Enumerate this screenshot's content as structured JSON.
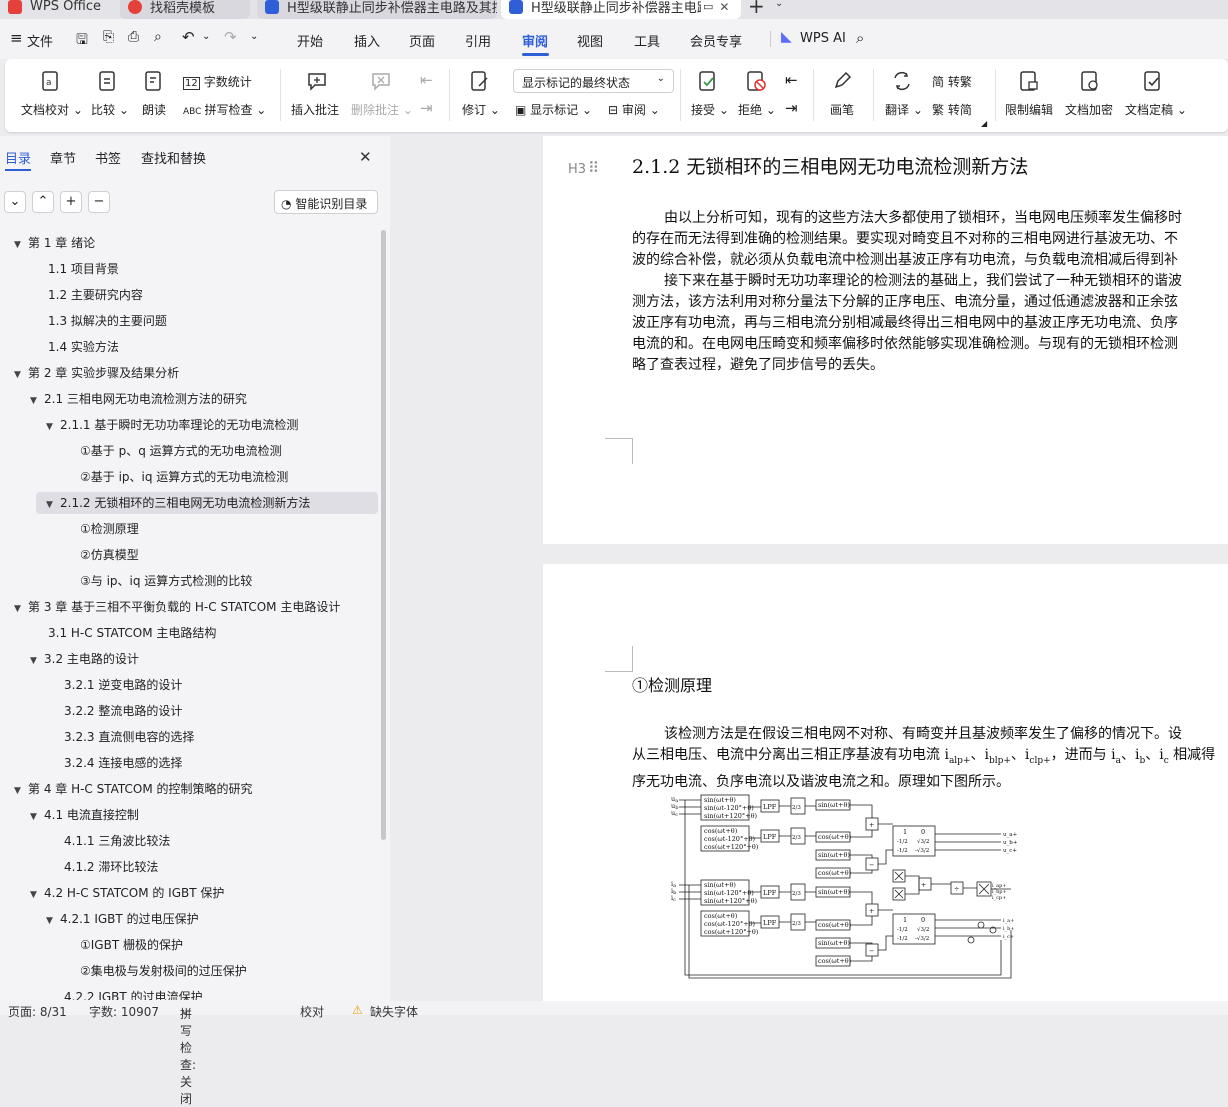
{
  "tabs": [
    {
      "label": "WPS Office",
      "icon_color": "#e5413a"
    },
    {
      "label": "找稻壳模板",
      "icon_color": "#e5413a"
    },
    {
      "label": "H型级联静止同步补偿器主电路及其控",
      "icon_color": "#2e5fd6"
    },
    {
      "label": "H型级联静止同步补偿器主电路",
      "icon_color": "#2e5fd6"
    }
  ],
  "menu": {
    "file": "文件",
    "items": [
      "开始",
      "插入",
      "页面",
      "引用",
      "审阅",
      "视图",
      "工具",
      "会员专享"
    ],
    "active": "审阅",
    "wps_ai": "WPS AI"
  },
  "ribbon": {
    "doc_check": "文档校对",
    "compare": "比较",
    "read_aloud": "朗读",
    "word_count": "字数统计",
    "spell_check": "拼写检查",
    "insert_comment": "插入批注",
    "delete_comment": "删除批注",
    "revise": "修订",
    "display_state": "显示标记的最终状态",
    "show_markup": "显示标记",
    "review": "审阅",
    "accept": "接受",
    "reject": "拒绝",
    "pen": "画笔",
    "translate": "翻译",
    "to_traditional": "转繁",
    "to_simplified": "转简",
    "restrict_edit": "限制编辑",
    "encrypt": "文档加密",
    "finalize": "文档定稿"
  },
  "sidebar": {
    "tabs": [
      "目录",
      "章节",
      "书签",
      "查找和替换"
    ],
    "smart_toc": "智能识别目录",
    "toc": [
      {
        "label": "第 1 章  绪论",
        "level": 0,
        "expanded": true
      },
      {
        "label": "1.1 项目背景",
        "level": 1
      },
      {
        "label": "1.2 主要研究内容",
        "level": 1
      },
      {
        "label": "1.3 拟解决的主要问题",
        "level": 1
      },
      {
        "label": "1.4  实验方法",
        "level": 1
      },
      {
        "label": "第 2 章  实验步骤及结果分析",
        "level": 0,
        "expanded": true
      },
      {
        "label": "2.1 三相电网无功电流检测方法的研究",
        "level": 1,
        "expanded": true
      },
      {
        "label": "2.1.1 基于瞬时无功功率理论的无功电流检测",
        "level": 2,
        "expanded": true
      },
      {
        "label": "①基于 p、q 运算方式的无功电流检测",
        "level": 3
      },
      {
        "label": "②基于 ip、iq 运算方式的无功电流检测",
        "level": 3
      },
      {
        "label": "2.1.2 无锁相环的三相电网无功电流检测新方法",
        "level": 2,
        "expanded": true,
        "selected": true
      },
      {
        "label": "①检测原理",
        "level": 3
      },
      {
        "label": "②仿真模型",
        "level": 3
      },
      {
        "label": "③与 ip、iq 运算方式检测的比较",
        "level": 3
      },
      {
        "label": "第 3 章  基于三相不平衡负载的 H-C STATCOM 主电路设计",
        "level": 0,
        "expanded": true
      },
      {
        "label": "3.1 H-C STATCOM 主电路结构",
        "level": 1
      },
      {
        "label": "3.2 主电路的设计",
        "level": 1,
        "expanded": true
      },
      {
        "label": "3.2.1 逆变电路的设计",
        "level": 2
      },
      {
        "label": "3.2.2 整流电路的设计",
        "level": 2
      },
      {
        "label": "3.2.3 直流侧电容的选择",
        "level": 2
      },
      {
        "label": "3.2.4 连接电感的选择",
        "level": 2
      },
      {
        "label": "第 4 章  H-C STATCOM 的控制策略的研究",
        "level": 0,
        "expanded": true
      },
      {
        "label": "4.1 电流直接控制",
        "level": 1,
        "expanded": true
      },
      {
        "label": "4.1.1 三角波比较法",
        "level": 2
      },
      {
        "label": "4.1.2 滞环比较法",
        "level": 2
      },
      {
        "label": "4.2 H-C STATCOM 的 IGBT 保护",
        "level": 1,
        "expanded": true
      },
      {
        "label": "4.2.1 IGBT 的过电压保护",
        "level": 2,
        "expanded": true
      },
      {
        "label": "①IGBT 栅极的保护",
        "level": 3
      },
      {
        "label": "②集电极与发射极间的过压保护",
        "level": 3
      },
      {
        "label": "4.2.2 IGBT 的过电流保护",
        "level": 2
      }
    ]
  },
  "document": {
    "heading_marker": "H3",
    "heading": "2.1.2 无锁相环的三相电网无功电流检测新方法",
    "p1": [
      "由以上分析可知，现有的这些方法大多都使用了锁相环，当电网电压频率发生偏移时",
      "的存在而无法得到准确的检测结果。要实现对畸变且不对称的三相电网进行基波无功、不",
      "波的综合补偿，就必须从负载电流中检测出基波正序有功电流，与负载电流相减后得到补"
    ],
    "p2": [
      "接下来在基于瞬时无功功率理论的检测法的基础上，我们尝试了一种无锁相环的谐波",
      "测方法，该方法利用对称分量法下分解的正序电压、电流分量，通过低通滤波器和正余弦",
      "波正序有功电流，再与三相电流分别相减最终得出三相电网中的基波正序无功电流、负序",
      "电流的和。在电网电压畸变和频率偏移时依然能够实现准确检测。与现有的无锁相环检测",
      "略了查表过程，避免了同步信号的丢失。"
    ],
    "subheading": "①检测原理",
    "p3": [
      "该检测方法是在假设三相电网不对称、有畸变并且基波频率发生了偏移的情况下。设",
      "从三相电压、电流中分离出三相正序基波有功电流 i",
      "序无功电流、负序电流以及谐波电流之和。原理如下图所示。"
    ],
    "p3_mid": {
      "a": "alp+",
      "sep1": "、i",
      "b": "blp+",
      "sep2": "、i",
      "c": "clp+",
      "tail": "，进而与 i",
      "ia": "a",
      "s1": "、i",
      "ib": "b",
      "s2": "、i",
      "ic": "c",
      "end": " 相减得"
    },
    "diagram": {
      "sin_block": [
        "sin(ωt+θ)",
        "sin(ωt-120°+θ)",
        "sin(ωt+120°+θ)"
      ],
      "cos_block": [
        "cos(ωt+θ)",
        "cos(ωt-120°+θ)",
        "cos(ωt+120°+θ)"
      ],
      "lpf": "LPF",
      "gain": "2/3",
      "mult_sin": "sin(ωt+θ)",
      "mult_cos": "cos(ωt+θ)",
      "matrix": [
        [
          "1",
          "0"
        ],
        [
          "-1/2",
          "√3/2"
        ],
        [
          "-1/2",
          "-√3/2"
        ]
      ],
      "u_inputs": [
        "u_a",
        "u_b",
        "u_c"
      ],
      "i_inputs": [
        "i_a",
        "i_b",
        "i_c"
      ],
      "u_outputs": [
        "u_a+",
        "u_b+",
        "u_c+"
      ],
      "i_outputs": [
        "i_ap+",
        "i_bp+",
        "i_cp+"
      ],
      "i_final": [
        "i_a+",
        "i_b+",
        "i_c+"
      ]
    }
  },
  "status": {
    "page": "页面: 8/31",
    "words": "字数: 10907",
    "spell": "拼写检查: 关闭",
    "proof": "校对",
    "font_missing": "缺失字体"
  }
}
